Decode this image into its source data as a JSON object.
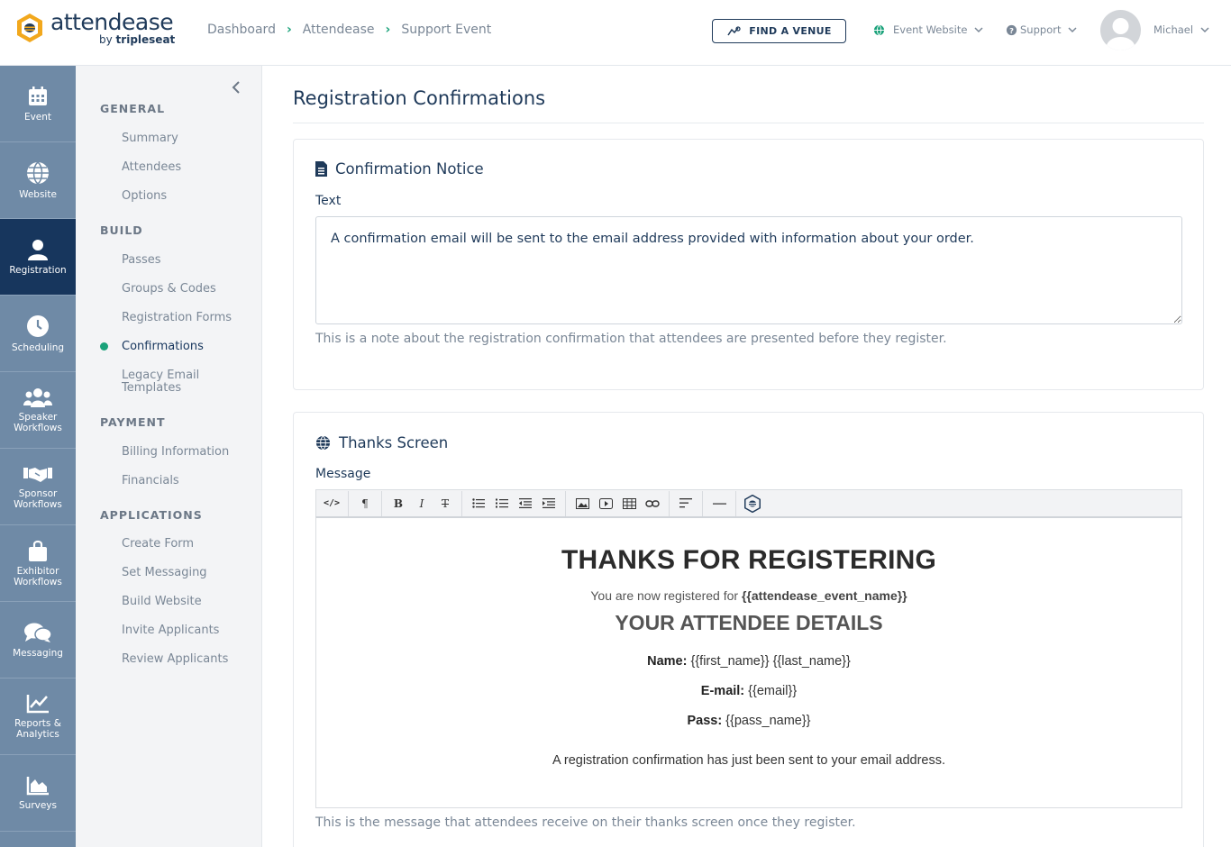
{
  "brand": {
    "name": "attendease",
    "by": "by ",
    "by_company": "tripleseat"
  },
  "breadcrumb": [
    "Dashboard",
    "Attendease",
    "Support Event"
  ],
  "header": {
    "find_venue": "FIND A VENUE",
    "event_website": "Event Website",
    "support": "Support",
    "user": "Michael"
  },
  "iconbar": [
    {
      "label": "Event",
      "icon": "calendar-icon"
    },
    {
      "label": "Website",
      "icon": "globe-icon"
    },
    {
      "label": "Registration",
      "icon": "user-icon",
      "active": true
    },
    {
      "label": "Scheduling",
      "icon": "clock-icon"
    },
    {
      "label": "Speaker Workflows",
      "icon": "people-icon"
    },
    {
      "label": "Sponsor Workflows",
      "icon": "handshake-icon"
    },
    {
      "label": "Exhibitor Workflows",
      "icon": "bag-icon"
    },
    {
      "label": "Messaging",
      "icon": "chat-icon"
    },
    {
      "label": "Reports & Analytics",
      "icon": "chart-line-icon"
    },
    {
      "label": "Surveys",
      "icon": "chart-area-icon"
    }
  ],
  "subnav": {
    "general": "GENERAL",
    "general_items": [
      "Summary",
      "Attendees",
      "Options"
    ],
    "build": "BUILD",
    "build_items": [
      "Passes",
      "Groups & Codes",
      "Registration Forms",
      "Confirmations",
      "Legacy Email Templates"
    ],
    "payment": "PAYMENT",
    "payment_items": [
      "Billing Information",
      "Financials"
    ],
    "applications": "APPLICATIONS",
    "applications_items": [
      "Create Form",
      "Set Messaging",
      "Build Website",
      "Invite Applicants",
      "Review Applicants"
    ],
    "active": "Confirmations"
  },
  "page": {
    "title": "Registration Confirmations",
    "notice": {
      "heading": "Confirmation Notice",
      "label": "Text",
      "value": "A confirmation email will be sent to the email address provided with information about your order.",
      "help": "This is a note about the registration confirmation that attendees are presented before they register."
    },
    "thanks": {
      "heading": "Thanks Screen",
      "label": "Message",
      "editor": {
        "h1": "THANKS FOR REGISTERING",
        "registered_prefix": "You are now registered for ",
        "event_token": "{{attendease_event_name}}",
        "h2": "YOUR ATTENDEE DETAILS",
        "name_label": "Name:",
        "name_value": " {{first_name}} {{last_name}}",
        "email_label": "E-mail:",
        "email_value": " {{email}}",
        "pass_label": "Pass:",
        "pass_value": " {{pass_name}}",
        "footer": "A registration confirmation has just been sent to your email address."
      },
      "help": "This is the message that attendees receive on their thanks screen once they register."
    }
  },
  "colors": {
    "nav_dark": "#17365d",
    "nav": "#6f8aa6",
    "accent": "#1aa27a",
    "text": "#1f3a5a"
  }
}
